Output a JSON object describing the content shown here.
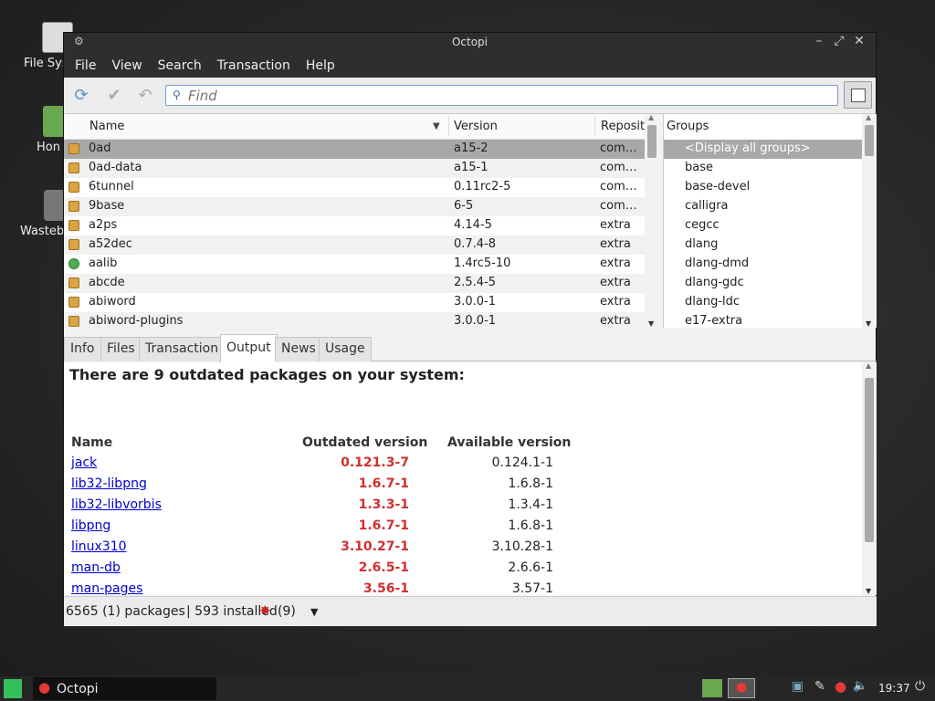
{
  "desktop": {
    "icons": [
      {
        "label": "File Sys"
      },
      {
        "label": "Hon"
      },
      {
        "label": "Wasteb"
      }
    ]
  },
  "window": {
    "title": "Octopi",
    "menu": [
      "File",
      "View",
      "Search",
      "Transaction",
      "Help"
    ],
    "search": {
      "placeholder": "Find"
    },
    "columns": {
      "name": "Name",
      "version": "Version",
      "repo": "Reposit"
    },
    "packages": [
      {
        "name": "0ad",
        "version": "a15-2",
        "repo": "com…",
        "installed": false,
        "selected": true
      },
      {
        "name": "0ad-data",
        "version": "a15-1",
        "repo": "com…",
        "installed": false
      },
      {
        "name": "6tunnel",
        "version": "0.11rc2-5",
        "repo": "com…",
        "installed": false
      },
      {
        "name": "9base",
        "version": "6-5",
        "repo": "com…",
        "installed": false
      },
      {
        "name": "a2ps",
        "version": "4.14-5",
        "repo": "extra",
        "installed": false
      },
      {
        "name": "a52dec",
        "version": "0.7.4-8",
        "repo": "extra",
        "installed": false
      },
      {
        "name": "aalib",
        "version": "1.4rc5-10",
        "repo": "extra",
        "installed": true
      },
      {
        "name": "abcde",
        "version": "2.5.4-5",
        "repo": "extra",
        "installed": false
      },
      {
        "name": "abiword",
        "version": "3.0.0-1",
        "repo": "extra",
        "installed": false
      },
      {
        "name": "abiword-plugins",
        "version": "3.0.0-1",
        "repo": "extra",
        "installed": false
      }
    ],
    "groups_header": "Groups",
    "groups": [
      "<Display all groups>",
      "base",
      "base-devel",
      "calligra",
      "cegcc",
      "dlang",
      "dlang-dmd",
      "dlang-gdc",
      "dlang-ldc",
      "e17-extra"
    ],
    "tabs": [
      "Info",
      "Files",
      "Transaction",
      "Output",
      "News",
      "Usage"
    ],
    "active_tab": "Output",
    "output": {
      "heading": "There are 9 outdated packages on your system:",
      "col_name": "Name",
      "col_outdated": "Outdated version",
      "col_available": "Available version",
      "rows": [
        {
          "name": "jack",
          "outdated": "0.121.3-7",
          "available": "0.124.1-1"
        },
        {
          "name": "lib32-libpng",
          "outdated": "1.6.7-1",
          "available": "1.6.8-1"
        },
        {
          "name": "lib32-libvorbis",
          "outdated": "1.3.3-1",
          "available": "1.3.4-1"
        },
        {
          "name": "libpng",
          "outdated": "1.6.7-1",
          "available": "1.6.8-1"
        },
        {
          "name": "linux310",
          "outdated": "3.10.27-1",
          "available": "3.10.28-1"
        },
        {
          "name": "man-db",
          "outdated": "2.6.5-1",
          "available": "2.6.6-1"
        },
        {
          "name": "man-pages",
          "outdated": "3.56-1",
          "available": "3.57-1"
        }
      ]
    },
    "status": {
      "packages": "6565 (1) packages",
      "installed": "| 593 installed",
      "updates": "(9)"
    }
  },
  "taskbar": {
    "app": "Octopi",
    "time": "19:37"
  },
  "colors": {
    "outdated": "#d32f2f",
    "link": "#0000cc",
    "selection": "#a8a8a8"
  }
}
